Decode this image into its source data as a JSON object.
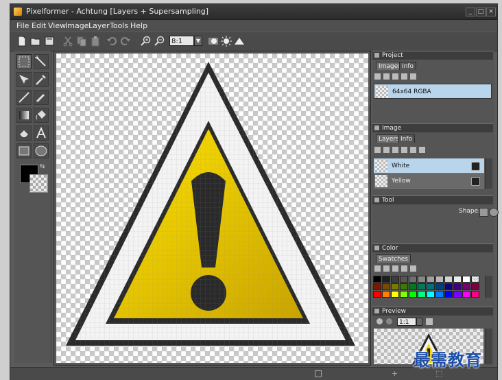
{
  "window": {
    "title": "Pixelformer - Achtung [Layers + Supersampling]",
    "controls": [
      "_",
      "□",
      "×"
    ]
  },
  "menu": [
    "File",
    "Edit",
    "View",
    "Image",
    "Layer",
    "Tools",
    "Help"
  ],
  "toolbar": {
    "icons": [
      "new-file-icon",
      "open-file-icon",
      "save-icon",
      "cut-icon",
      "copy-icon",
      "paste-icon",
      "undo-icon",
      "redo-icon",
      "zoom-in-icon",
      "zoom-out-icon"
    ],
    "zoom_value": "8:1",
    "extra_icons": [
      "preview-bg-icon",
      "sun-icon",
      "triangle-icon"
    ]
  },
  "tools": [
    "marquee-select-icon",
    "magic-wand-icon",
    "move-icon",
    "eyedropper-icon",
    "line-icon",
    "brush-icon",
    "gradient-icon",
    "fill-bucket-icon",
    "eraser-icon",
    "text-icon",
    "rectangle-icon",
    "ellipse-icon"
  ],
  "colors": {
    "primary": "#000000",
    "secondary": "transparent",
    "warning_yellow": "#f0d400",
    "warning_dark": "#2a2a2a"
  },
  "panels": {
    "project": {
      "title": "Project",
      "tabs": [
        "Images",
        "Info"
      ],
      "items": [
        {
          "label": "64x64 RGBA"
        }
      ]
    },
    "image": {
      "title": "Image",
      "tabs": [
        "Layers",
        "Info"
      ],
      "layers": [
        {
          "label": "White"
        },
        {
          "label": "Yellow"
        }
      ]
    },
    "tool": {
      "title": "Tool",
      "shape_label": "Shape:"
    },
    "color": {
      "title": "Color",
      "tabs": [
        "Swatches"
      ],
      "swatch_rows": [
        [
          "#000000",
          "#1e1e1e",
          "#3c3c3c",
          "#555555",
          "#6e6e6e",
          "#878787",
          "#a0a0a0",
          "#b9b9b9",
          "#d2d2d2",
          "#ebebeb",
          "#ffffff",
          "transparent"
        ],
        [
          "#7a1a00",
          "#7a4a00",
          "#7a7a00",
          "#3a7a00",
          "#007a1a",
          "#007a5a",
          "#00707a",
          "#00407a",
          "#10007a",
          "#40007a",
          "#7a007a",
          "#7a0040"
        ],
        [
          "#ff0000",
          "#ff8000",
          "#ffff00",
          "#80ff00",
          "#00ff00",
          "#00ff80",
          "#00ffff",
          "#0080ff",
          "#0000ff",
          "#8000ff",
          "#ff00ff",
          "#ff0080"
        ]
      ]
    },
    "preview": {
      "title": "Preview",
      "zoom_value": "1:1"
    }
  },
  "watermark": "最需教育"
}
